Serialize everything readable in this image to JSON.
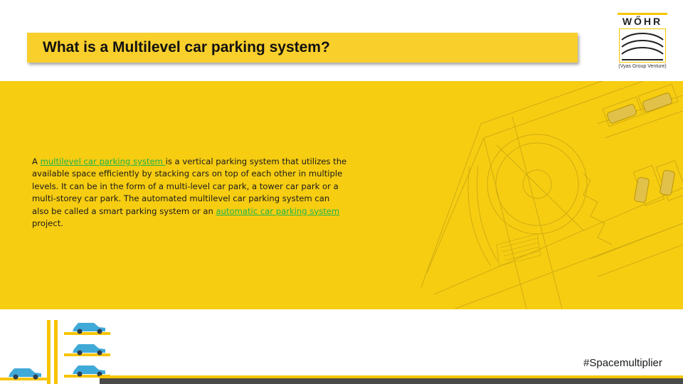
{
  "slide": {
    "title": "What is a Multilevel car parking system?",
    "hashtag": "#Spacemultiplier"
  },
  "logo": {
    "wordmark": "WŐHR",
    "subtitle": "(Vyas Group Venture)"
  },
  "body": {
    "part1": "A ",
    "link1": "multilevel car parking system ",
    "part2": "is a vertical parking system that utilizes the available space efficiently by stacking cars on top of each other in multiple levels. It can be in the form of a multi-level car park, a tower car park or a multi-storey car park. The automated multilevel car parking system can also be called a smart parking system or an ",
    "link2": "automatic car parking system ",
    "part3": "project."
  },
  "colors": {
    "brand_yellow": "#f7cd12",
    "title_yellow": "#f9cf2c",
    "link_green": "#1fb34a",
    "stripe_gray": "#4a4a4a",
    "car_blue": "#3fa9d8"
  }
}
